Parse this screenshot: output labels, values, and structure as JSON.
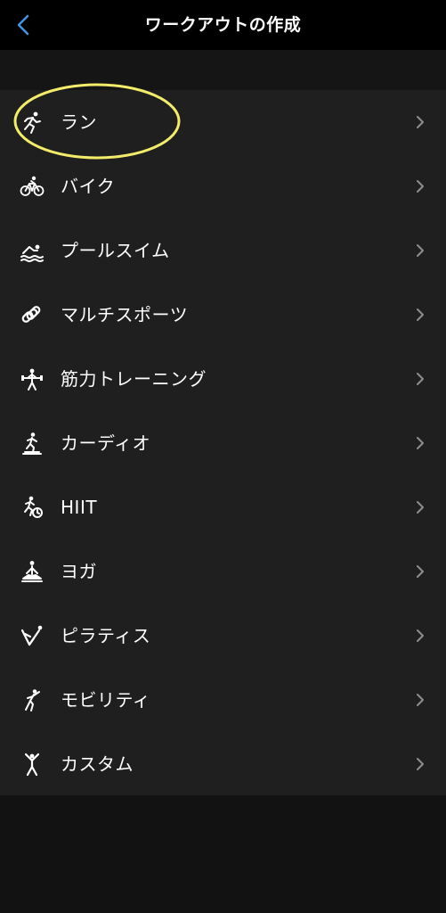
{
  "nav": {
    "title": "ワークアウトの作成",
    "back_icon": "chevron-left-icon"
  },
  "accent_color": "#4a90e2",
  "highlight_color": "#f2ec6a",
  "items": [
    {
      "label": "ラン",
      "icon": "running-icon"
    },
    {
      "label": "バイク",
      "icon": "bicycle-icon"
    },
    {
      "label": "プールスイム",
      "icon": "swimming-icon"
    },
    {
      "label": "マルチスポーツ",
      "icon": "multisport-icon"
    },
    {
      "label": "筋力トレーニング",
      "icon": "strength-icon"
    },
    {
      "label": "カーディオ",
      "icon": "cardio-icon"
    },
    {
      "label": "HIIT",
      "icon": "hiit-icon"
    },
    {
      "label": "ヨガ",
      "icon": "yoga-icon"
    },
    {
      "label": "ピラティス",
      "icon": "pilates-icon"
    },
    {
      "label": "モビリティ",
      "icon": "mobility-icon"
    },
    {
      "label": "カスタム",
      "icon": "custom-icon"
    }
  ]
}
